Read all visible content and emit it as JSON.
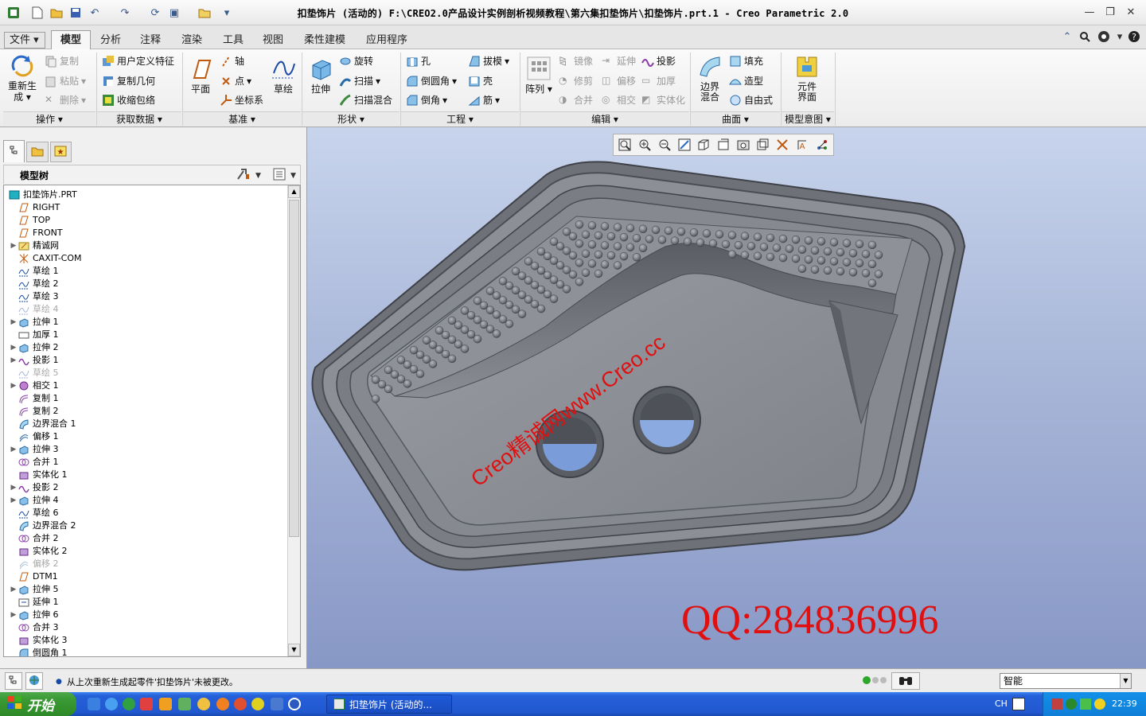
{
  "window": {
    "title": "扣垫饰片 (活动的) F:\\CREO2.0产品设计实例剖析视频教程\\第六集扣垫饰片\\扣垫饰片.prt.1 - Creo Parametric 2.0"
  },
  "tabs": [
    "文件",
    "模型",
    "分析",
    "注释",
    "渲染",
    "工具",
    "视图",
    "柔性建模",
    "应用程序"
  ],
  "active_tab": "模型",
  "ribbon": {
    "regen": "重新生成",
    "copy": "复制",
    "paste": "粘贴",
    "delete": "删除",
    "udf": "用户定义特征",
    "copy_geom": "复制几何",
    "shrinkwrap": "收缩包络",
    "plane": "平面",
    "axis": "轴",
    "point": "点",
    "csys": "坐标系",
    "sketch": "草绘",
    "extrude": "拉伸",
    "revolve": "旋转",
    "sweep": "扫描",
    "swept_blend": "扫描混合",
    "hole": "孔",
    "round": "倒圆角",
    "chamfer": "倒角",
    "draft": "拔模",
    "shell": "壳",
    "rib": "筋",
    "pattern": "阵列",
    "mirror": "镜像",
    "extend": "延伸",
    "project": "投影",
    "trim": "修剪",
    "offset": "偏移",
    "thicken": "加厚",
    "merge": "合并",
    "intersect": "相交",
    "solidify": "实体化",
    "boundary_blend": "边界混合",
    "fill": "填充",
    "style": "造型",
    "freestyle": "自由式",
    "component_interface": "元件界面",
    "groups": {
      "operations": "操作",
      "get_data": "获取数据",
      "datum": "基准",
      "shapes": "形状",
      "engineering": "工程",
      "editing": "编辑",
      "surfaces": "曲面",
      "model_intent": "模型意图"
    }
  },
  "model_tree": {
    "header": "模型树",
    "items": [
      {
        "label": "扣垫饰片.PRT",
        "icon": "part-icon",
        "dim": false,
        "expand": false,
        "root": true
      },
      {
        "label": "RIGHT",
        "icon": "datum-plane-icon",
        "dim": false,
        "expand": false
      },
      {
        "label": "TOP",
        "icon": "datum-plane-icon",
        "dim": false,
        "expand": false
      },
      {
        "label": "FRONT",
        "icon": "datum-plane-icon",
        "dim": false,
        "expand": false
      },
      {
        "label": "精诚网",
        "icon": "datum-group-icon",
        "dim": false,
        "expand": true
      },
      {
        "label": "CAXIT-COM",
        "icon": "csys-icon",
        "dim": false,
        "expand": false
      },
      {
        "label": "草绘 1",
        "icon": "sketch-icon",
        "dim": false,
        "expand": false
      },
      {
        "label": "草绘 2",
        "icon": "sketch-icon",
        "dim": false,
        "expand": false
      },
      {
        "label": "草绘 3",
        "icon": "sketch-icon",
        "dim": false,
        "expand": false
      },
      {
        "label": "草绘 4",
        "icon": "sketch-icon",
        "dim": true,
        "expand": false
      },
      {
        "label": "拉伸 1",
        "icon": "extrude-icon",
        "dim": false,
        "expand": true
      },
      {
        "label": "加厚 1",
        "icon": "thicken-icon",
        "dim": false,
        "expand": false
      },
      {
        "label": "拉伸 2",
        "icon": "extrude-icon",
        "dim": false,
        "expand": true
      },
      {
        "label": "投影 1",
        "icon": "project-icon",
        "dim": false,
        "expand": true
      },
      {
        "label": "草绘 5",
        "icon": "sketch-icon",
        "dim": true,
        "expand": false
      },
      {
        "label": "相交 1",
        "icon": "intersect-icon",
        "dim": false,
        "expand": true
      },
      {
        "label": "复制 1",
        "icon": "copy-surface-icon",
        "dim": false,
        "expand": false
      },
      {
        "label": "复制 2",
        "icon": "copy-surface-icon",
        "dim": false,
        "expand": false
      },
      {
        "label": "边界混合 1",
        "icon": "boundary-blend-icon",
        "dim": false,
        "expand": false
      },
      {
        "label": "偏移 1",
        "icon": "offset-icon",
        "dim": false,
        "expand": false
      },
      {
        "label": "拉伸 3",
        "icon": "extrude-icon",
        "dim": false,
        "expand": true
      },
      {
        "label": "合并 1",
        "icon": "merge-icon",
        "dim": false,
        "expand": false
      },
      {
        "label": "实体化 1",
        "icon": "solidify-icon",
        "dim": false,
        "expand": false
      },
      {
        "label": "投影 2",
        "icon": "project-icon",
        "dim": false,
        "expand": true
      },
      {
        "label": "拉伸 4",
        "icon": "extrude-icon",
        "dim": false,
        "expand": true
      },
      {
        "label": "草绘 6",
        "icon": "sketch-icon",
        "dim": false,
        "expand": false
      },
      {
        "label": "边界混合 2",
        "icon": "boundary-blend-icon",
        "dim": false,
        "expand": false
      },
      {
        "label": "合并 2",
        "icon": "merge-icon",
        "dim": false,
        "expand": false
      },
      {
        "label": "实体化 2",
        "icon": "solidify-icon",
        "dim": false,
        "expand": false
      },
      {
        "label": "偏移 2",
        "icon": "offset-icon",
        "dim": true,
        "expand": false
      },
      {
        "label": "DTM1",
        "icon": "datum-plane-icon",
        "dim": false,
        "expand": false
      },
      {
        "label": "拉伸 5",
        "icon": "extrude-icon",
        "dim": false,
        "expand": true
      },
      {
        "label": "延伸 1",
        "icon": "extend-icon",
        "dim": false,
        "expand": false
      },
      {
        "label": "拉伸 6",
        "icon": "extrude-icon",
        "dim": false,
        "expand": true
      },
      {
        "label": "合并 3",
        "icon": "merge-icon",
        "dim": false,
        "expand": false
      },
      {
        "label": "实体化 3",
        "icon": "solidify-icon",
        "dim": false,
        "expand": false
      },
      {
        "label": "倒圆角 1",
        "icon": "round-icon",
        "dim": false,
        "expand": false
      }
    ]
  },
  "viewport": {
    "watermark": "Creo精诚网www.Creo.cc",
    "qq": "QQ:284836996"
  },
  "status": {
    "message": "从上次重新生成起零件'扣垫饰片'未被更改。",
    "filter": "智能"
  },
  "taskbar": {
    "start": "开始",
    "task": "扣垫饰片 (活动的...",
    "lang": "CH",
    "time": "22:39"
  },
  "colors": {
    "accent": "#2b5fc0",
    "model_gray": "#8e9298",
    "watermark_red": "#e01010"
  }
}
